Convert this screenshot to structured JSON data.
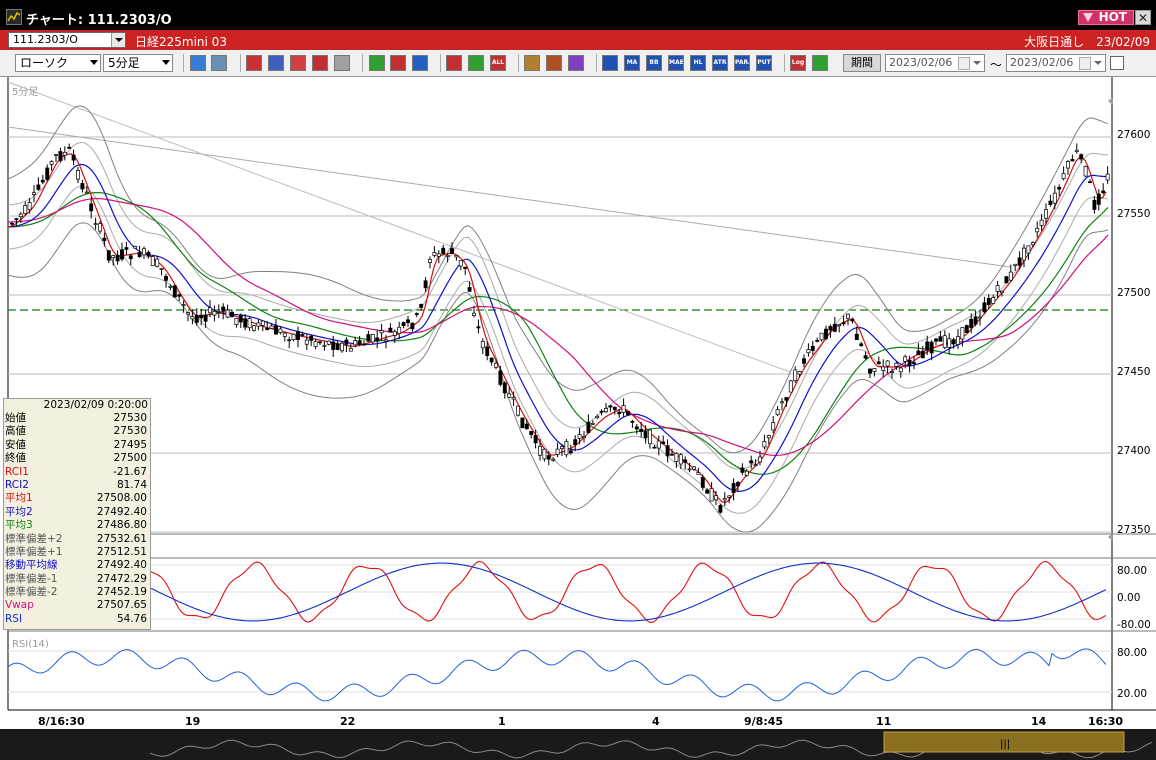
{
  "window": {
    "title": "チャート: 111.2303/O",
    "hot_label": "HOT",
    "close_label": "✕"
  },
  "symbol_bar": {
    "code": "111.2303/O",
    "name": "日経225mini 03",
    "session": "大阪日通し",
    "date": "23/02/09"
  },
  "toolbar": {
    "chart_type": "ローソク",
    "interval": "5分足",
    "period_label": "期間",
    "date_from": "2023/02/06",
    "date_to": "2023/02/06",
    "range_sep": "〜",
    "buttons": [
      {
        "name": "search-button",
        "label": "",
        "color": "#3a7bd5"
      },
      {
        "name": "grid-button",
        "label": "",
        "color": "#6a8fb5"
      },
      {
        "name": "line-tool-button",
        "label": "",
        "color": "#c83232"
      },
      {
        "name": "zoom-button",
        "label": "",
        "color": "#4060c0"
      },
      {
        "name": "compare-button",
        "label": "",
        "color": "#d04040"
      },
      {
        "name": "multi-button",
        "label": "",
        "color": "#c03030"
      },
      {
        "name": "lock-button",
        "label": "",
        "color": "#a0a0a0"
      },
      {
        "name": "pen-button",
        "label": "",
        "color": "#30a030"
      },
      {
        "name": "cursor-button",
        "label": "",
        "color": "#c03030"
      },
      {
        "name": "rotate-button",
        "label": "",
        "color": "#2060c0"
      },
      {
        "name": "candle-button",
        "label": "",
        "color": "#c03030"
      },
      {
        "name": "bars-button",
        "label": "",
        "color": "#30a030"
      },
      {
        "name": "all-button",
        "label": "ALL",
        "color": "#c03030"
      },
      {
        "name": "settings-button",
        "label": "",
        "color": "#b08030"
      },
      {
        "name": "brush-button",
        "label": "",
        "color": "#b05020"
      },
      {
        "name": "palette-button",
        "label": "",
        "color": "#8040c0"
      },
      {
        "name": "vol-button",
        "label": "",
        "color": "#2050b0"
      },
      {
        "name": "ma-button",
        "label": "MA",
        "color": "#2050b0"
      },
      {
        "name": "bb-button",
        "label": "BB",
        "color": "#2050b0"
      },
      {
        "name": "mae-button",
        "label": "MAE",
        "color": "#2050b0"
      },
      {
        "name": "hl-button",
        "label": "HL",
        "color": "#2050b0"
      },
      {
        "name": "atr-button",
        "label": "ATR",
        "color": "#2050b0"
      },
      {
        "name": "para-button",
        "label": "PARA",
        "color": "#2050b0"
      },
      {
        "name": "put-button",
        "label": "PUT",
        "color": "#2050b0"
      },
      {
        "name": "log-button",
        "label": "Log",
        "color": "#c03030"
      },
      {
        "name": "export-button",
        "label": "",
        "color": "#30a030"
      }
    ]
  },
  "chart": {
    "interval_label": "5分足",
    "price_labels": [
      "27600",
      "27550",
      "27500",
      "27450",
      "27400",
      "27350"
    ],
    "rci_labels": [
      "80.00",
      "0.00",
      "-80.00"
    ],
    "rsi_title": "RSI(14)",
    "rsi_labels": [
      "80.00",
      "20.00"
    ],
    "x_labels": [
      "8/16:30",
      "19",
      "22",
      "1",
      "4",
      "9/8:45",
      "11",
      "14",
      "16:30"
    ],
    "colors": {
      "up": "#ffffff",
      "down": "#000000",
      "ma1": "#d01010",
      "ma2": "#1010c8",
      "ma3": "#108010",
      "vwap": "#d0107a",
      "bb": "#808080",
      "rci1": "#e01010",
      "rci2": "#1030c8",
      "rsi": "#2060e0",
      "dash": "#108010"
    }
  },
  "legend": {
    "timestamp": "2023/02/09  0:20:00",
    "rows": [
      {
        "label": "始値",
        "value": "27530",
        "color": "#000"
      },
      {
        "label": "高値",
        "value": "27530",
        "color": "#000"
      },
      {
        "label": "安値",
        "value": "27495",
        "color": "#000"
      },
      {
        "label": "終値",
        "value": "27500",
        "color": "#000"
      },
      {
        "label": "RCI1",
        "value": "-21.67",
        "color": "#d01010"
      },
      {
        "label": "RCI2",
        "value": "81.74",
        "color": "#1010c8"
      },
      {
        "label": "平均1",
        "value": "27508.00",
        "color": "#d01010"
      },
      {
        "label": "平均2",
        "value": "27492.40",
        "color": "#1010c8"
      },
      {
        "label": "平均3",
        "value": "27486.80",
        "color": "#108010"
      },
      {
        "label": "標準偏差+2",
        "value": "27532.61",
        "color": "#555"
      },
      {
        "label": "標準偏差+1",
        "value": "27512.51",
        "color": "#555"
      },
      {
        "label": "移動平均線",
        "value": "27492.40",
        "color": "#1010c8"
      },
      {
        "label": "標準偏差-1",
        "value": "27472.29",
        "color": "#555"
      },
      {
        "label": "標準偏差-2",
        "value": "27452.19",
        "color": "#555"
      },
      {
        "label": "Vwap",
        "value": "27507.65",
        "color": "#d0107a"
      },
      {
        "label": "RSI",
        "value": "54.76",
        "color": "#1030c8"
      }
    ]
  }
}
